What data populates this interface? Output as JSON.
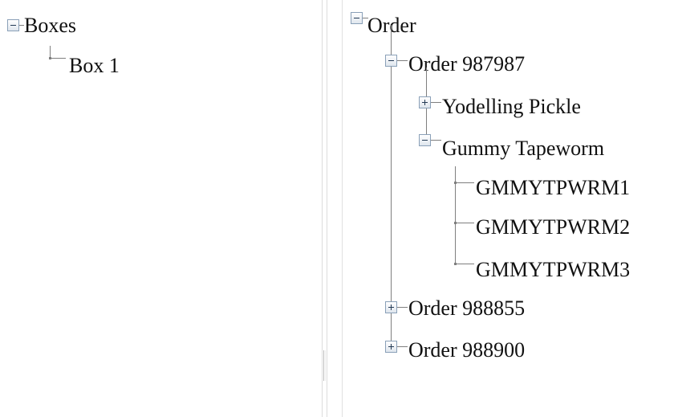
{
  "left_tree": {
    "root": {
      "label": "Boxes",
      "expanded": true
    },
    "children": [
      {
        "label": "Box 1"
      }
    ]
  },
  "right_tree": {
    "root": {
      "label": "Order",
      "expanded": true
    },
    "orders": [
      {
        "label": "Order 987987",
        "expanded": true,
        "items": [
          {
            "label": "Yodelling Pickle",
            "expanded": false
          },
          {
            "label": "Gummy Tapeworm",
            "expanded": true,
            "units": [
              "GMMYTPWRM1",
              "GMMYTPWRM2",
              "GMMYTPWRM3"
            ]
          }
        ]
      },
      {
        "label": "Order 988855",
        "expanded": false
      },
      {
        "label": "Order 988900",
        "expanded": false
      }
    ]
  },
  "colors": {
    "expander_border": "#8aa0b8",
    "expander_glyph": "#243b55",
    "connector": "#7f7f7f",
    "text": "#111111"
  },
  "icons": {
    "collapse": "minus-box-icon",
    "expand": "plus-box-icon"
  }
}
